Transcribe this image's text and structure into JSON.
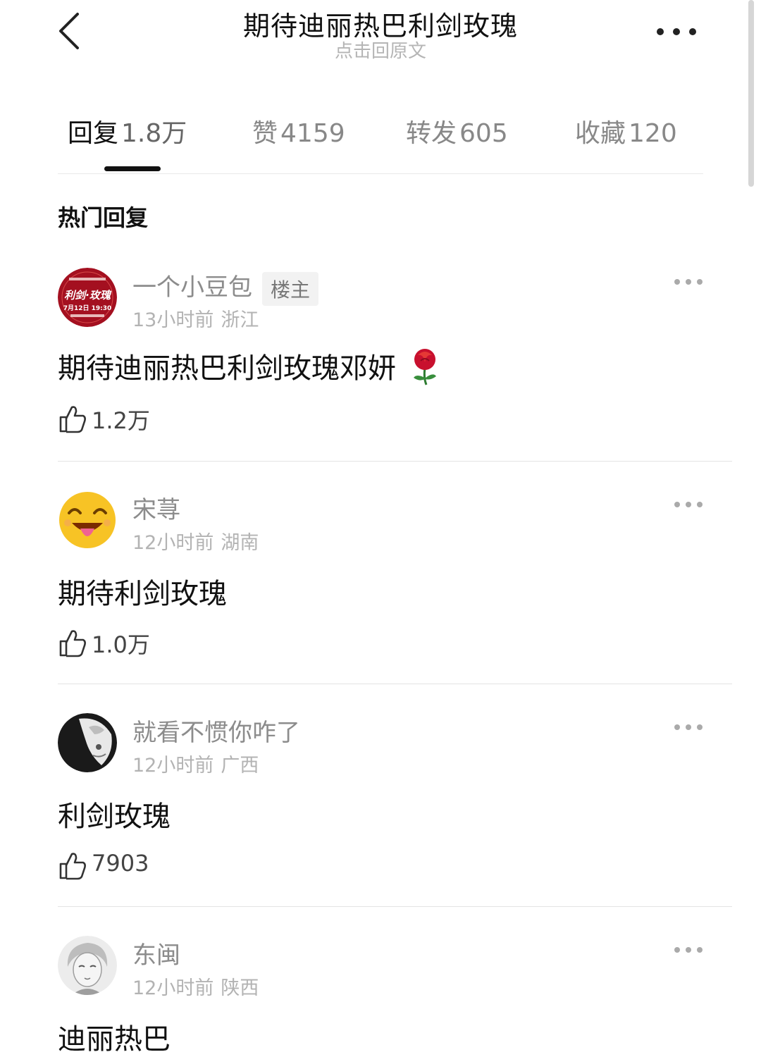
{
  "header": {
    "title": "期待迪丽热巴利剑玫瑰",
    "subtitle": "点击回原文"
  },
  "tabs": [
    {
      "label": "回复",
      "count": "1.8万",
      "active": true
    },
    {
      "label": "赞",
      "count": "4159"
    },
    {
      "label": "转发",
      "count": "605"
    },
    {
      "label": "收藏",
      "count": "120"
    }
  ],
  "section_title": "热门回复",
  "comments": [
    {
      "name": "一个小豆包",
      "badge": "楼主",
      "time": "13小时前",
      "location": "浙江",
      "text": "期待迪丽热巴利剑玫瑰邓妍",
      "likes": "1.2万",
      "avatar": "poster-avatar",
      "avatar_text_1": "利剑·玫瑰",
      "avatar_text_2": "7月12日 19:30"
    },
    {
      "name": "宋荨",
      "time": "12小时前",
      "location": "湖南",
      "text": "期待利剑玫瑰",
      "likes": "1.0万",
      "avatar": "grinning-emoji-avatar"
    },
    {
      "name": "就看不惯你咋了",
      "time": "12小时前",
      "location": "广西",
      "text": "利剑玫瑰",
      "likes": "7903",
      "avatar": "cat-avatar"
    },
    {
      "name": "东闽",
      "time": "12小时前",
      "location": "陕西",
      "text": "迪丽热巴",
      "avatar": "anime-avatar"
    }
  ],
  "colors": {
    "accent_dark": "#111111",
    "muted_text": "#8c8c8c",
    "divider": "#e4e4e4",
    "rose_red": "#c8102e",
    "emoji_yellow": "#f7c325"
  },
  "icons": {
    "back": "chevron-left-icon",
    "more": "more-dots-icon",
    "like": "thumbs-up-icon",
    "rose": "rose-emoji"
  }
}
